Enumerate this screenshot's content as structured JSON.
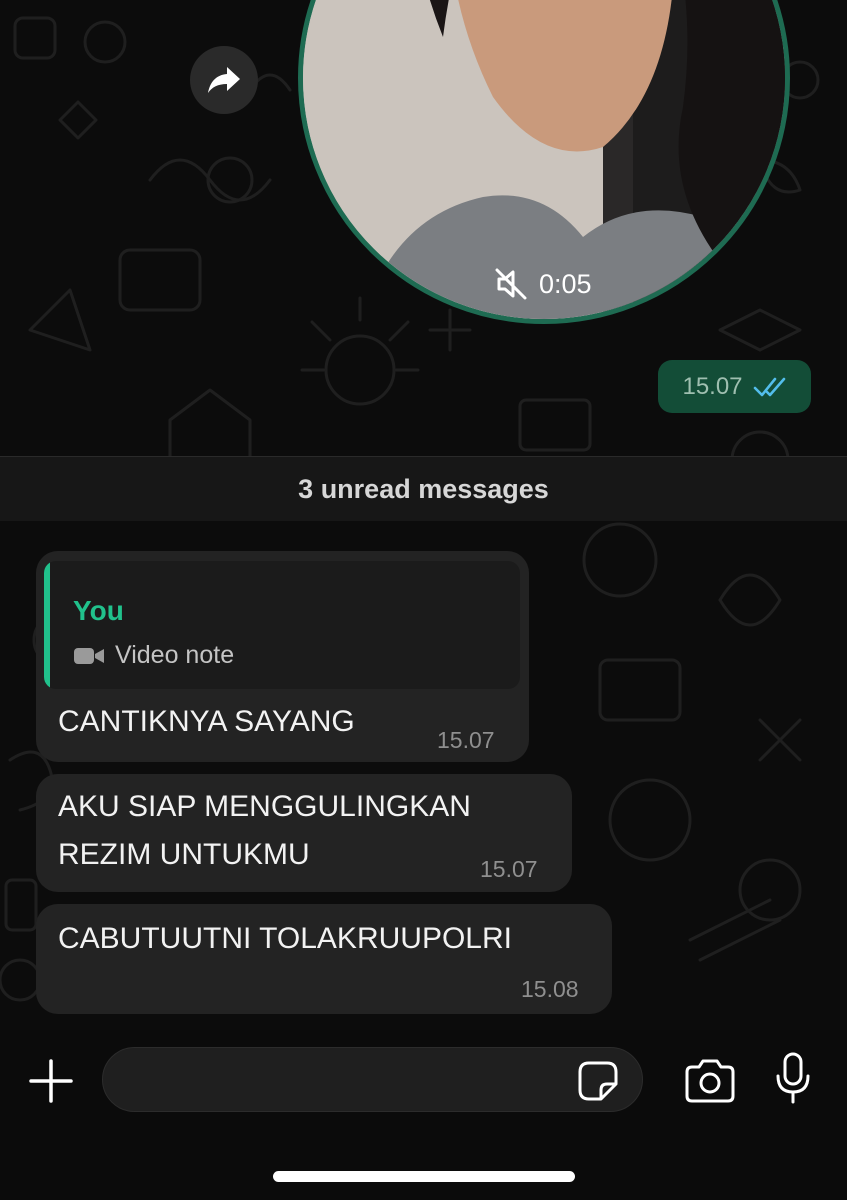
{
  "video_note": {
    "duration": "0:05",
    "muted_icon": "speaker-muted-icon",
    "forward_icon": "forward-arrow-icon"
  },
  "outgoing": {
    "time": "15.07",
    "status_icon": "double-check-icon"
  },
  "divider": {
    "unread_label": "3 unread messages"
  },
  "messages": [
    {
      "reply": {
        "author": "You",
        "icon": "video-camera-icon",
        "text": "Video note"
      },
      "lines": [
        "CANTIKNYA SAYANG"
      ],
      "time": "15.07"
    },
    {
      "lines": [
        "AKU SIAP MENGGULINGKAN",
        "REZIM UNTUKMU"
      ],
      "time": "15.07"
    },
    {
      "lines": [
        "CABUTUUTNI TOLAKRUUPOLRI"
      ],
      "time": "15.08"
    }
  ],
  "composer": {
    "placeholder": "",
    "icons": [
      "plus-icon",
      "sticker-icon",
      "camera-icon",
      "microphone-icon"
    ]
  },
  "colors": {
    "accent": "#21c18c",
    "outgoing_bubble": "#134d37",
    "incoming_bubble": "#232323",
    "read_receipt": "#53bdeb",
    "ring": "#1e6b52"
  }
}
